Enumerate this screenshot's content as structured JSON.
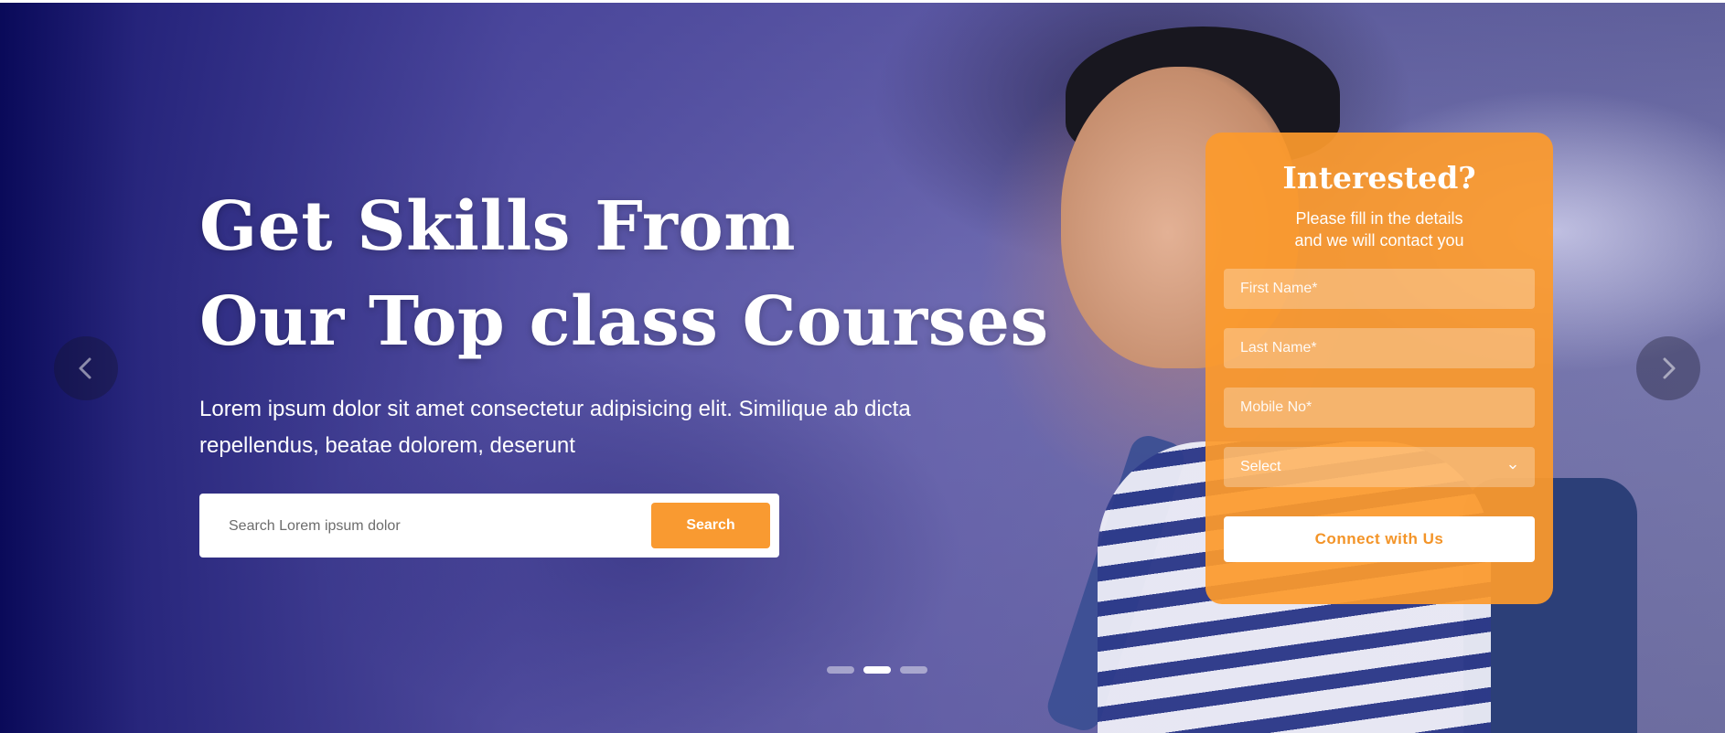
{
  "hero": {
    "headline_line1": "Get Skills From",
    "headline_line2": "Our Top class Courses",
    "lead": "Lorem ipsum dolor sit amet consectetur adipisicing elit. Similique ab dicta repellendus, beatae dolorem, deserunt"
  },
  "search": {
    "placeholder": "Search Lorem ipsum dolor",
    "button_label": "Search"
  },
  "carousel": {
    "prev_icon": "chevron-left-icon",
    "next_icon": "chevron-right-icon",
    "slide_count": 3,
    "active_slide": 2
  },
  "form": {
    "title": "Interested?",
    "subtitle_line1": "Please fill in the details",
    "subtitle_line2": "and we will contact you",
    "first_name_placeholder": "First Name*",
    "last_name_placeholder": "Last Name*",
    "mobile_placeholder": "Mobile No*",
    "select_value": "Select",
    "submit_label": "Connect with Us"
  },
  "colors": {
    "accent": "#f99a31",
    "overlay": "#1a1a6e"
  }
}
